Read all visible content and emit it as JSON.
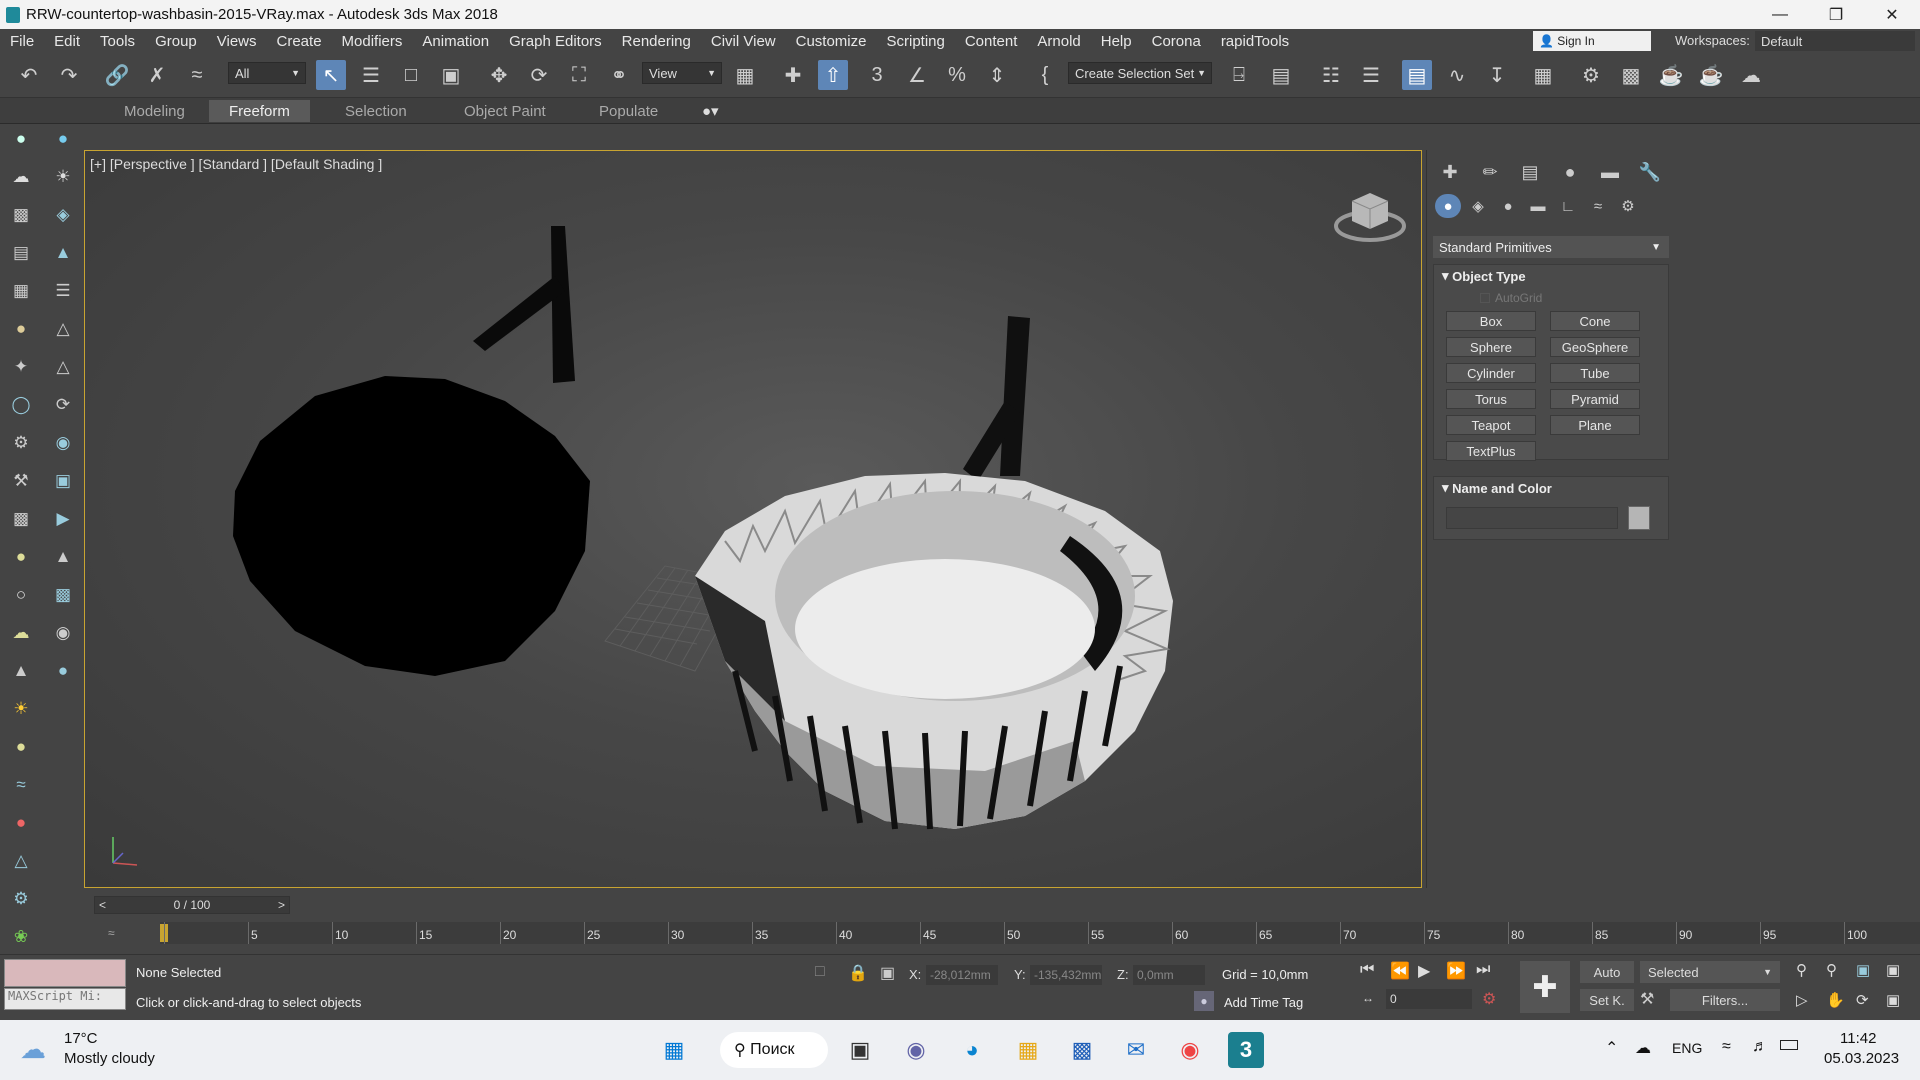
{
  "window": {
    "title": "RRW-countertop-washbasin-2015-VRay.max - Autodesk 3ds Max 2018"
  },
  "menu": [
    "File",
    "Edit",
    "Tools",
    "Group",
    "Views",
    "Create",
    "Modifiers",
    "Animation",
    "Graph Editors",
    "Rendering",
    "Civil View",
    "Customize",
    "Scripting",
    "Content",
    "Arnold",
    "Help",
    "Corona",
    "rapidTools"
  ],
  "signin": "Sign In",
  "workspaces": {
    "label": "Workspaces:",
    "value": "Default"
  },
  "toolbar": {
    "filter": "All",
    "ref_coord": "View",
    "selection_set": "Create Selection Set"
  },
  "ribbon_tabs": [
    "Modeling",
    "Freeform",
    "Selection",
    "Object Paint",
    "Populate"
  ],
  "viewport": {
    "label": "[+] [Perspective ] [Standard ] [Default Shading ]"
  },
  "panel": {
    "category": "Standard Primitives",
    "object_type": {
      "title": "Object Type",
      "autogrid": "AutoGrid",
      "buttons": [
        "Box",
        "Cone",
        "Sphere",
        "GeoSphere",
        "Cylinder",
        "Tube",
        "Torus",
        "Pyramid",
        "Teapot",
        "Plane",
        "TextPlus"
      ]
    },
    "name_color": {
      "title": "Name and Color"
    }
  },
  "timeline": {
    "frame": "0 / 100",
    "prev": "<",
    "next": ">",
    "ticks": [
      "0",
      "5",
      "10",
      "15",
      "20",
      "25",
      "30",
      "35",
      "40",
      "45",
      "50",
      "55",
      "60",
      "65",
      "70",
      "75",
      "80",
      "85",
      "90",
      "95",
      "100"
    ]
  },
  "status": {
    "selection": "None Selected",
    "prompt": "Click or click-and-drag to select objects",
    "maxscript": "MAXScript Mi:",
    "x_label": "X:",
    "x": "-28,012mm",
    "y_label": "Y:",
    "y": "-135,432mm",
    "z_label": "Z:",
    "z": "0,0mm",
    "grid": "Grid = 10,0mm",
    "add_time_tag": "Add Time Tag",
    "auto": "Auto",
    "setk": "Set K.",
    "key_mode": "Selected",
    "filters": "Filters...",
    "frame_field": "0"
  },
  "taskbar": {
    "temp": "17°C",
    "weather": "Mostly cloudy",
    "search": "Поиск",
    "lang": "ENG",
    "time": "11:42",
    "date": "05.03.2023"
  }
}
